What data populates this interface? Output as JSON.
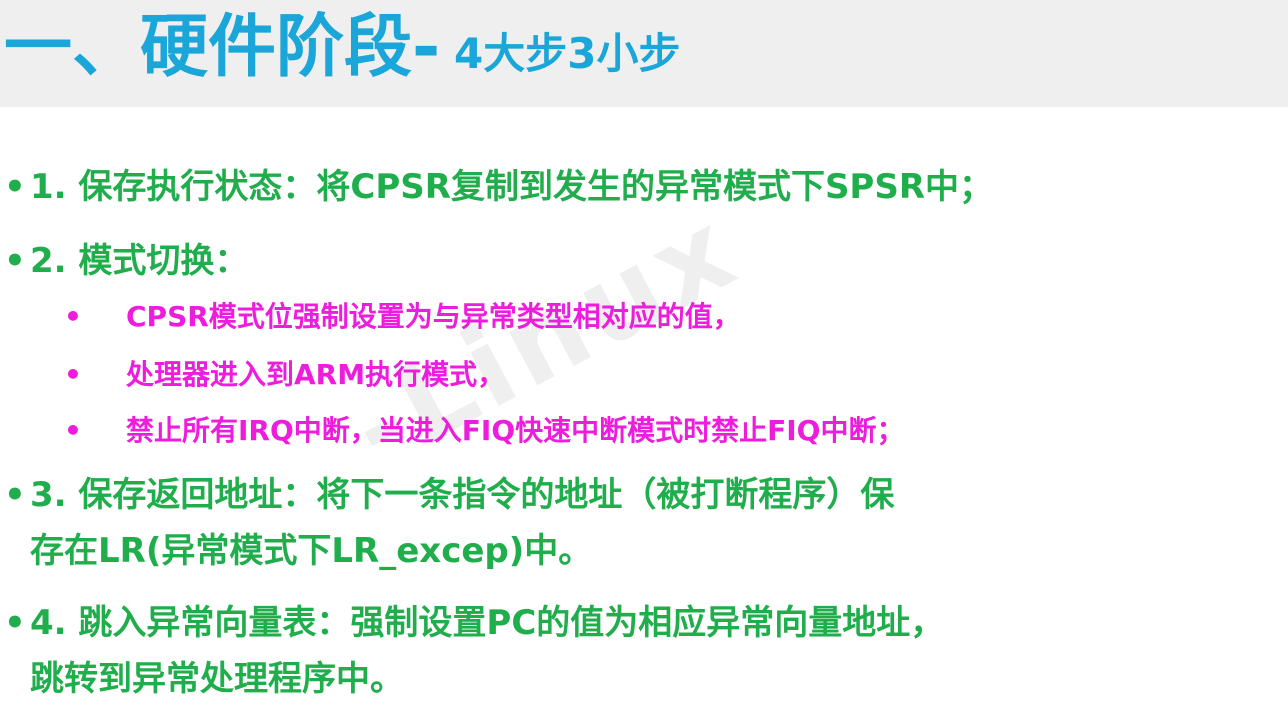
{
  "title": {
    "main": "一、硬件阶段-",
    "sub": "4大步3小步"
  },
  "watermark": "-Linux",
  "bullets": {
    "b1": "1. 保存执行状态：将CPSR复制到发生的异常模式下SPSR中；",
    "b2": "2. 模式切换：",
    "b2_subs": [
      "CPSR模式位强制设置为与异常类型相对应的值，",
      "处理器进入到ARM执行模式，",
      "禁止所有IRQ中断，当进入FIQ快速中断模式时禁止FIQ中断；"
    ],
    "b3_line1": "3.  保存返回地址：将下一条指令的地址（被打断程序）保",
    "b3_line2": "存在LR(异常模式下LR_excep)中。",
    "b4_line1": "4.  跳入异常向量表：强制设置PC的值为相应异常向量地址，",
    "b4_line2": "跳转到异常处理程序中。"
  },
  "bullet_symbol": "•",
  "colors": {
    "title": "#1aa6d8",
    "title_bar": "#efefef",
    "green": "#1fae4b",
    "magenta": "#ee1cdc"
  }
}
